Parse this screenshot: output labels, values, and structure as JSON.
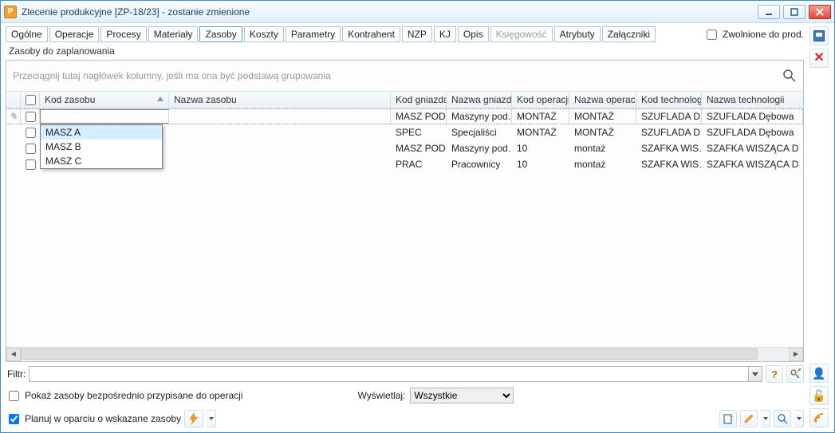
{
  "window": {
    "title": "Zlecenie produkcyjne  [ZP-18/23] - zostanie zmienione",
    "app_icon": "P"
  },
  "tabs": [
    "Ogólne",
    "Operacje",
    "Procesy",
    "Materiały",
    "Zasoby",
    "Koszty",
    "Parametry",
    "Kontrahent",
    "NZP",
    "KJ",
    "Opis",
    "Księgowość",
    "Atrybuty",
    "Załączniki"
  ],
  "active_tab": "Zasoby",
  "disabled_tab": "Księgowość",
  "release_label": "Zwolnione do prod.",
  "section_title": "Zasoby do zaplanowania",
  "group_hint": "Przeciągnij tutaj nagłówek kolumny, jeśli ma ona być podstawą grupowania",
  "columns": {
    "kod": "Kod zasobu",
    "nazwa": "Nazwa zasobu",
    "kg": "Kod gniazda",
    "ng": "Nazwa gniazda",
    "ko": "Kod operacji",
    "no": "Nazwa operacji",
    "kt": "Kod technologii",
    "nt": "Nazwa technologii"
  },
  "dropdown_items": [
    "MASZ A",
    "MASZ B",
    "MASZ C"
  ],
  "rows": [
    {
      "edit": true,
      "kod": "",
      "nazwa": "",
      "kg": "MASZ POD",
      "ng": "Maszyny pod…",
      "ko": "MONTAŻ",
      "no": "MONTAŻ",
      "kt": "SZUFLADA D…",
      "nt": "SZUFLADA Dębowa"
    },
    {
      "kod": "",
      "nazwa": "",
      "kg": "SPEC",
      "ng": "Specjaliści",
      "ko": "MONTAŻ",
      "no": "MONTAŻ",
      "kt": "SZUFLADA D…",
      "nt": "SZUFLADA Dębowa"
    },
    {
      "kod": "",
      "nazwa": "",
      "kg": "MASZ POD",
      "ng": "Maszyny pod…",
      "ko": "10",
      "no": "montaż",
      "kt": "SZAFKA WIS…",
      "nt": "SZAFKA WISZĄCA D"
    },
    {
      "kod": "",
      "nazwa": "",
      "kg": "PRAC",
      "ng": "Pracownicy",
      "ko": "10",
      "no": "montaż",
      "kt": "SZAFKA WIS…",
      "nt": "SZAFKA WISZĄCA D"
    }
  ],
  "filter_label": "Filtr:",
  "opt_show_direct": "Pokaż zasoby bezpośrednio przypisane do operacji",
  "opt_display_label": "Wyświetlaj:",
  "opt_display_value": "Wszystkie",
  "opt_plan": "Planuj w oparciu o wskazane zasoby",
  "edit_indicator": "✎"
}
